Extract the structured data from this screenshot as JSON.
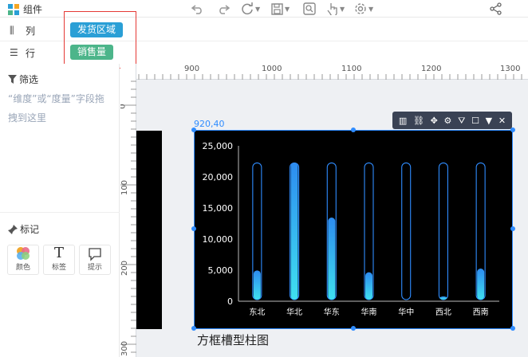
{
  "app": {
    "title": "组件"
  },
  "fields": {
    "columns_label": "列",
    "rows_label": "行",
    "column_chip": "发货区域",
    "row_chip": "销售量",
    "column_chip_color": "#2a9fd6",
    "row_chip_color": "#4cb58a"
  },
  "filter": {
    "title": "筛选",
    "hint": "“维度”或“度量”字段拖拽到这里"
  },
  "marks": {
    "title": "标记",
    "buttons": [
      {
        "label": "颜色",
        "icon": "color-palette-icon"
      },
      {
        "label": "标签",
        "icon": "text-T-icon"
      },
      {
        "label": "提示",
        "icon": "tooltip-icon"
      }
    ]
  },
  "rulers": {
    "top": [
      "900",
      "1000",
      "1100",
      "1200",
      "1300"
    ],
    "left": [
      "0",
      "100",
      "200",
      "300"
    ]
  },
  "component": {
    "position": "920,40",
    "caption": "方框槽型柱图"
  },
  "chart_data": {
    "type": "bar",
    "title": "",
    "xlabel": "",
    "ylabel": "",
    "categories": [
      "东北",
      "华北",
      "华东",
      "华南",
      "华中",
      "西北",
      "西南"
    ],
    "values": [
      4700,
      22000,
      13200,
      4400,
      0,
      400,
      5000
    ],
    "ylim": [
      0,
      25000
    ],
    "yticks": [
      "0",
      "5,000",
      "10,000",
      "15,000",
      "20,000",
      "25,000"
    ],
    "slot_max": 22000,
    "bar_style": "capsule slot outline with gradient fill",
    "bar_color_top": "#2d8cf0",
    "bar_color_bottom": "#3fe0f0",
    "background": "#000000",
    "grid": false
  }
}
